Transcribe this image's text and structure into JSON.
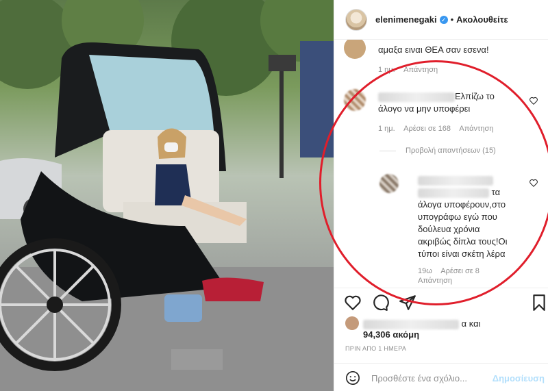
{
  "header": {
    "username": "elenimenegaki",
    "verified_mark": "✓",
    "separator": "•",
    "follow_label": "Ακολουθείτε"
  },
  "comments": [
    {
      "text": "αμαξα ειναι ΘΕΑ σαν εσενα!",
      "time": "1 ημ.",
      "reply": "Απάντηση"
    },
    {
      "text_line1": "Ελπίζω το",
      "text_line2": "άλογο να μην υποφέρει",
      "time": "1 ημ.",
      "likes": "Αρέσει σε 168",
      "reply": "Απάντηση"
    },
    {
      "text_lines": [
        "τα",
        "άλογα υποφέρουν,στο",
        "υπογράφω εγώ που",
        "δούλευα χρόνια",
        "ακριβώς δίπλα τους!Οι",
        "τύποι είναι σκέτη λέρα"
      ],
      "time": "19ω",
      "likes": "Αρέσει σε 8",
      "reply": "Απάντηση"
    }
  ],
  "view_replies": "Προβολή απαντήσεων (15)",
  "likes": {
    "suffix": "α και",
    "count": "94,306 ακόμη"
  },
  "time_ago": "ΠΡΙΝ ΑΠΟ 1 ΗΜΕΡΑ",
  "add_comment": {
    "placeholder": "Προσθέστε ένα σχόλιο...",
    "post": "Δημοσίευση"
  },
  "icons": [
    "heart-icon",
    "comment-icon",
    "share-icon",
    "bookmark-icon",
    "emoji-icon"
  ]
}
